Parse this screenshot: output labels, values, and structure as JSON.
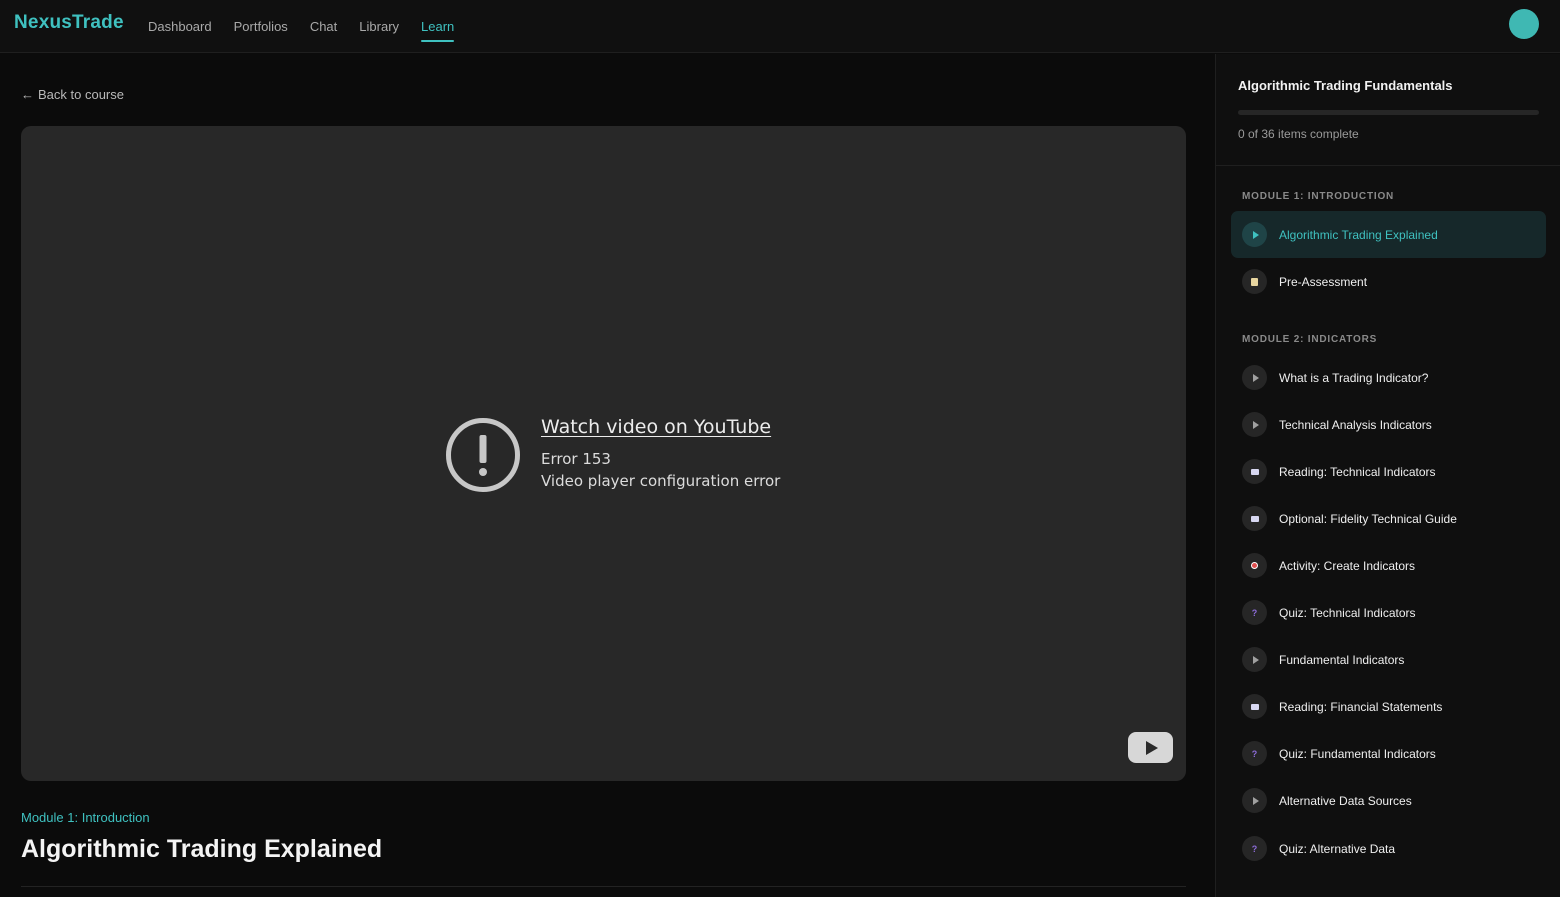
{
  "app": {
    "name": "NexusTrade"
  },
  "nav": {
    "items": [
      {
        "label": "Dashboard"
      },
      {
        "label": "Portfolios"
      },
      {
        "label": "Chat"
      },
      {
        "label": "Library"
      },
      {
        "label": "Learn"
      }
    ],
    "active": "Learn"
  },
  "back": {
    "label": "Back to course"
  },
  "video": {
    "link_text": "Watch video on YouTube",
    "error_code": "Error 153",
    "error_message": "Video player configuration error"
  },
  "lesson": {
    "module_label": "Module 1: Introduction",
    "title": "Algorithmic Trading Explained"
  },
  "course": {
    "title": "Algorithmic Trading Fundamentals",
    "progress_fraction": 0,
    "progress_text": "0 of 36 items complete"
  },
  "modules": [
    {
      "header": "MODULE 1: INTRODUCTION",
      "items": [
        {
          "label": "Algorithmic Trading Explained",
          "icon": "play-icon",
          "active": true
        },
        {
          "label": "Pre-Assessment",
          "icon": "memo-icon"
        }
      ]
    },
    {
      "header": "MODULE 2: INDICATORS",
      "items": [
        {
          "label": "What is a Trading Indicator?",
          "icon": "play-icon"
        },
        {
          "label": "Technical Analysis Indicators",
          "icon": "play-icon"
        },
        {
          "label": "Reading: Technical Indicators",
          "icon": "book-icon"
        },
        {
          "label": "Optional: Fidelity Technical Guide",
          "icon": "book-icon"
        },
        {
          "label": "Activity: Create Indicators",
          "icon": "target-icon"
        },
        {
          "label": "Quiz: Technical Indicators",
          "icon": "question-icon"
        },
        {
          "label": "Fundamental Indicators",
          "icon": "play-icon"
        },
        {
          "label": "Reading: Financial Statements",
          "icon": "book-icon"
        },
        {
          "label": "Quiz: Fundamental Indicators",
          "icon": "question-icon"
        },
        {
          "label": "Alternative Data Sources",
          "icon": "play-icon"
        },
        {
          "label": "Quiz: Alternative Data",
          "icon": "question-icon"
        }
      ]
    }
  ],
  "colors": {
    "accent": "#3fc1c0",
    "background": "#0b0b0b",
    "video_bg": "#282828"
  }
}
